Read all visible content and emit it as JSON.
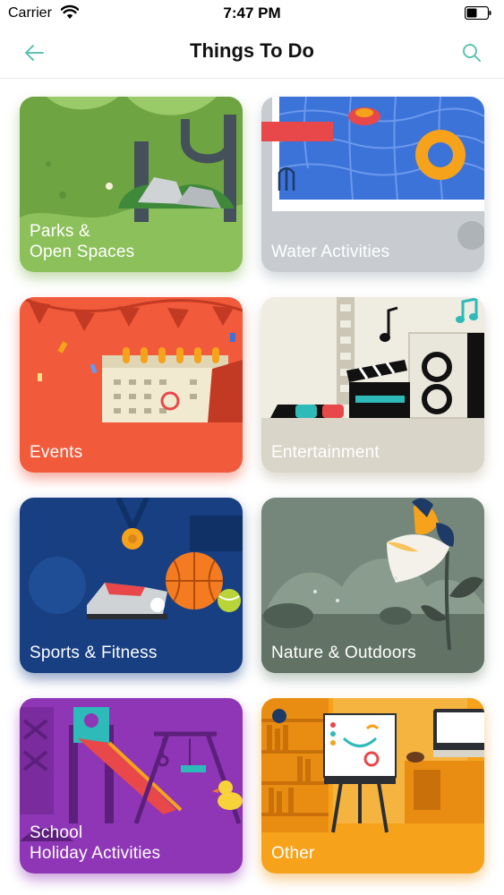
{
  "status_bar": {
    "carrier": "Carrier",
    "time": "7:47 PM",
    "wifi_icon": "wifi-icon",
    "battery_icon": "battery-icon"
  },
  "nav": {
    "title": "Things To Do",
    "back_icon": "arrow-left-icon",
    "search_icon": "search-icon",
    "accent_color": "#5fc2b0"
  },
  "categories": [
    {
      "label": "Parks &\nOpen Spaces",
      "color": "#7fb24f"
    },
    {
      "label": "Water Activities",
      "color": "#c8ccd1"
    },
    {
      "label": "Events",
      "color": "#f15a3a"
    },
    {
      "label": "Entertainment",
      "color": "#d9d5c8"
    },
    {
      "label": "Sports & Fitness",
      "color": "#173f82"
    },
    {
      "label": "Nature & Outdoors",
      "color": "#74877a"
    },
    {
      "label": "School\nHoliday Activities",
      "color": "#8e36b5"
    },
    {
      "label": "Other",
      "color": "#f7a21b"
    }
  ]
}
